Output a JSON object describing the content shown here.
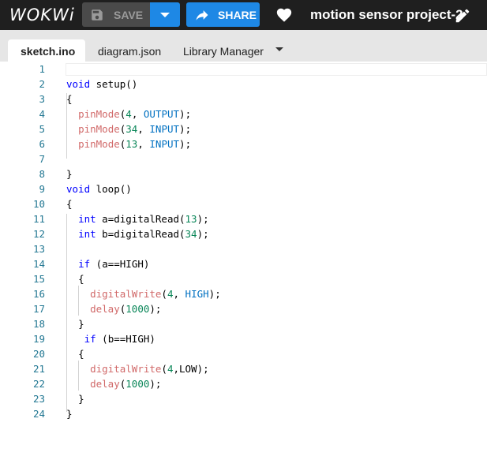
{
  "app": {
    "logo": "WOKWi"
  },
  "toolbar": {
    "save_label": "SAVE",
    "share_label": "SHARE",
    "project_title": "motion sensor project-2"
  },
  "tabs": [
    {
      "label": "sketch.ino",
      "active": true
    },
    {
      "label": "diagram.json",
      "active": false
    },
    {
      "label": "Library Manager",
      "active": false
    }
  ],
  "editor": {
    "line_numbers": [
      "1",
      "2",
      "3",
      "4",
      "5",
      "6",
      "7",
      "8",
      "9",
      "10",
      "11",
      "12",
      "13",
      "14",
      "15",
      "16",
      "17",
      "18",
      "19",
      "20",
      "21",
      "22",
      "23",
      "24"
    ],
    "lines": [
      "",
      "void setup()",
      "{",
      "  pinMode(4, OUTPUT);",
      "  pinMode(34, INPUT);",
      "  pinMode(13, INPUT);",
      "",
      "}",
      "void loop()",
      "{",
      "  int a=digitalRead(13);",
      "  int b=digitalRead(34);",
      "",
      "  if (a==HIGH)",
      "  {",
      "    digitalWrite(4, HIGH);",
      "    delay(1000);",
      "  }",
      "   if (b==HIGH)",
      "  {",
      "    digitalWrite(4,LOW);",
      "    delay(1000);",
      "  }",
      "}"
    ]
  },
  "colors": {
    "topbar_bg": "#1f1f1f",
    "accent": "#1e88e5",
    "line_number": "#237893",
    "keyword": "#0000ff",
    "function_call": "#d16969",
    "number": "#098658",
    "constant": "#0070c1"
  },
  "icons": {
    "save": "floppy-disk-icon",
    "dropdown": "caret-down-icon",
    "share": "share-arrow-icon",
    "like": "heart-icon",
    "edit": "pencil-icon",
    "tab_menu": "caret-down-icon"
  }
}
